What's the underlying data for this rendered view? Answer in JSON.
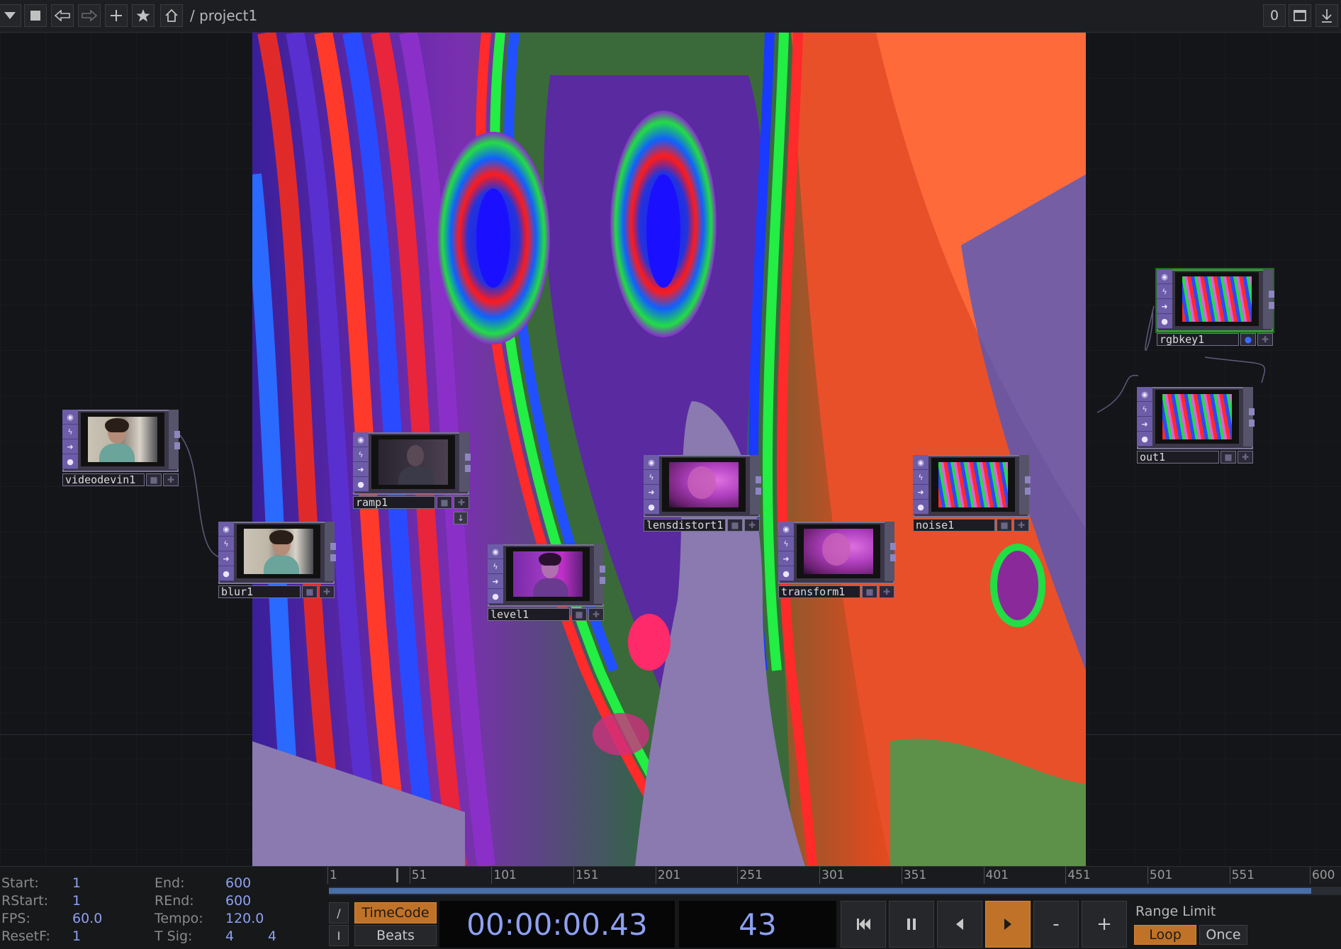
{
  "toolbar": {
    "path": "/ project1",
    "frame_counter": "0",
    "icons": [
      "menu-down-icon",
      "stop-icon",
      "back-icon",
      "forward-icon",
      "add-icon",
      "bookmark-icon",
      "home-icon",
      "maximize-icon",
      "download-icon"
    ]
  },
  "nodes": [
    {
      "id": "videodevin1",
      "label": "videodevin1",
      "thumb": "camera"
    },
    {
      "id": "blur1",
      "label": "blur1",
      "thumb": "camera"
    },
    {
      "id": "ramp1",
      "label": "ramp1",
      "thumb": "camera-dark"
    },
    {
      "id": "level1",
      "label": "level1",
      "thumb": "camera-purple"
    },
    {
      "id": "lensdistort1",
      "label": "lensdistort1",
      "thumb": "pink"
    },
    {
      "id": "transform1",
      "label": "transform1",
      "thumb": "pink"
    },
    {
      "id": "noise1",
      "label": "noise1",
      "thumb": "psychedelic"
    },
    {
      "id": "rgbkey1",
      "label": "rgbkey1",
      "thumb": "psychedelic",
      "selected": true
    },
    {
      "id": "out1",
      "label": "out1",
      "thumb": "psychedelic"
    }
  ],
  "timeline": {
    "start_label": "Start:",
    "start": "1",
    "rstart_label": "RStart:",
    "rstart": "1",
    "fps_label": "FPS:",
    "fps": "60.0",
    "resetf_label": "ResetF:",
    "resetf": "1",
    "end_label": "End:",
    "end": "600",
    "rend_label": "REnd:",
    "rend": "600",
    "tempo_label": "Tempo:",
    "tempo": "120.0",
    "tsig_label": "T Sig:",
    "tsig_a": "4",
    "tsig_b": "4",
    "ticks": [
      "1",
      "51",
      "101",
      "151",
      "201",
      "251",
      "301",
      "351",
      "401",
      "451",
      "501",
      "551",
      "600"
    ],
    "playhead_frame": 43,
    "timecode_label": "TimeCode",
    "beats_label": "Beats",
    "timecode": "00:00:00.43",
    "frame": "43",
    "range_limit_label": "Range Limit",
    "loop_label": "Loop",
    "once_label": "Once",
    "minus_label": "-",
    "plus_label": "+",
    "slash_label": "/",
    "bar_label": "I"
  },
  "colors": {
    "accent_orange": "#c07228",
    "readout_blue": "#8ea0f0",
    "node_purple": "#6d5ca8",
    "selected_green": "#3ea540"
  }
}
